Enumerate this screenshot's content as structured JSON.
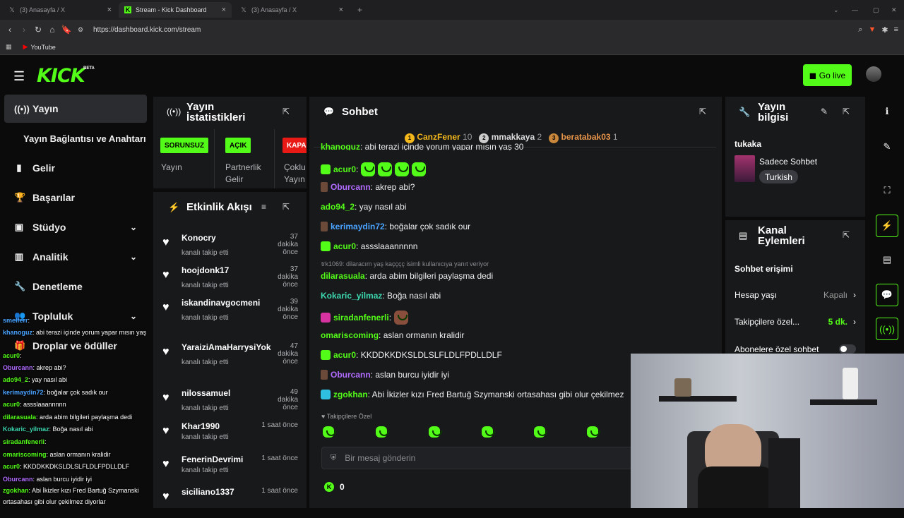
{
  "browser": {
    "tabs": [
      {
        "label": "(3) Anasayfa / X",
        "icon": "x-logo-icon"
      },
      {
        "label": "Stream - Kick Dashboard",
        "icon": "kick-logo-icon",
        "active": true
      },
      {
        "label": "(3) Anasayfa / X",
        "icon": "x-logo-icon"
      }
    ],
    "url": "https://dashboard.kick.com/stream",
    "bookmark": "YouTube"
  },
  "header": {
    "logo": "KICK",
    "beta": "BETA",
    "golive": "Go live",
    "colors": {
      "accent": "#53fc18",
      "panel": "#18191b"
    }
  },
  "sidebar": {
    "items": [
      {
        "label": "Yayın",
        "icon": "broadcast-icon"
      },
      {
        "label": "Yayın Bağlantısı ve Anahtarı",
        "icon": ""
      },
      {
        "label": "Gelir",
        "icon": "chart-icon"
      },
      {
        "label": "Başarılar",
        "icon": "trophy-icon"
      },
      {
        "label": "Stüdyo",
        "icon": "studio-icon"
      },
      {
        "label": "Analitik",
        "icon": "analytics-icon"
      },
      {
        "label": "Denetleme",
        "icon": "wrench-icon"
      },
      {
        "label": "Topluluk",
        "icon": "community-icon"
      },
      {
        "label": "Droplar ve ödüller",
        "icon": "gift-icon"
      }
    ]
  },
  "stats": {
    "title": "Yayın İstatistikleri",
    "badges": [
      {
        "label": "SORUNSUZ",
        "caption": "Yayın",
        "color": "#53fc18"
      },
      {
        "label": "AÇIK",
        "caption": "Partnerlik Gelir",
        "color": "#53fc18"
      },
      {
        "label": "KAPALI",
        "caption": "Çoklu Yayın",
        "color": "#e91916"
      }
    ]
  },
  "activity": {
    "title": "Etkinlik Akışı",
    "events": [
      {
        "name": "Konocry",
        "sub": "kanalı takip etti",
        "time": "37 dakika önce"
      },
      {
        "name": "hoojdonk17",
        "sub": "kanalı takip etti",
        "time": "37 dakika önce"
      },
      {
        "name": "iskandinavgocmeni",
        "sub": "kanalı takip etti",
        "time": "39 dakika önce"
      },
      {
        "name": "YaraiziAmaHarrysiYok",
        "sub": "kanalı takip etti",
        "time": "47 dakika önce"
      },
      {
        "name": "nilossamuel",
        "sub": "kanalı takip etti",
        "time": "49 dakika önce"
      },
      {
        "name": "Khar1990",
        "sub": "kanalı takip etti",
        "time": "1 saat önce"
      },
      {
        "name": "FenerinDevrimi",
        "sub": "kanalı takip etti",
        "time": "1 saat önce"
      },
      {
        "name": "siciliano1337",
        "sub": "",
        "time": "1 saat önce"
      }
    ]
  },
  "chat": {
    "title": "Sohbet",
    "top": [
      {
        "rank": "1",
        "name": "CanzFener",
        "count": "10"
      },
      {
        "rank": "2",
        "name": "mmakkaya",
        "count": "2"
      },
      {
        "rank": "3",
        "name": "beratabak03",
        "count": "1"
      }
    ],
    "messages": [
      {
        "user": "khanoguz",
        "color": "#53fc18",
        "text": ": abi terazi içinde yorum yapar mısın yaş 30"
      },
      {
        "user": "acur0",
        "color": "#53fc18",
        "text": ":"
      },
      {
        "user": "Oburcann",
        "color": "#b16cff",
        "text": ": akrep abi?"
      },
      {
        "user": "ado94_2",
        "color": "#53fc18",
        "text": ": yay nasıl abi"
      },
      {
        "user": "kerimaydin72",
        "color": "#4aa3ff",
        "text": ": boğalar çok sadık our"
      },
      {
        "user": "acur0",
        "color": "#53fc18",
        "text": ": assslaaannnnn"
      },
      {
        "user": "dilarasuala",
        "color": "#53fc18",
        "text": ": arda abim bilgileri paylaşma dedi"
      },
      {
        "user": "Kokaric_yilmaz",
        "color": "#3dd8b0",
        "text": ": Boğa nasıl abi"
      },
      {
        "user": "siradanfenerli",
        "color": "#53fc18",
        "text": ":"
      },
      {
        "user": "omariscoming",
        "color": "#53fc18",
        "text": ": aslan ormanın kralidir"
      },
      {
        "user": "acur0",
        "color": "#53fc18",
        "text": ": KKDDKKDKSLDLSLFLDLFPDLLDLF"
      },
      {
        "user": "Oburcann",
        "color": "#b16cff",
        "text": ": aslan burcu iyidir iyi"
      },
      {
        "user": "zgokhan",
        "color": "#53fc18",
        "text": ": Abi İkizler kızı Fred Bartuğ Szymanski ortasahası gibi olur çekilmez"
      }
    ],
    "reply": "trk1069: dilaracım yaş kaçççç isimli kullanıcıya yanıt veriyor",
    "followers_label": "Takipçilere Özel",
    "placeholder": "Bir mesaj gönderin",
    "kick_count": "0"
  },
  "info": {
    "title": "Yayın bilgisi",
    "user": "tukaka",
    "category": "Sadece Sohbet",
    "language": "Turkish"
  },
  "actions": {
    "title": "Kanal Eylemleri",
    "subtitle": "Sohbet erişimi",
    "rows": [
      {
        "label": "Hesap yaşı",
        "value": "Kapalı"
      },
      {
        "label": "Takipçilere özel...",
        "value": "5 dk."
      },
      {
        "label": "Abonelere özel sohbet",
        "value": ""
      }
    ]
  },
  "overlay_chat": [
    {
      "user": "smelferr",
      "text": ":",
      "color": "#4aa3ff"
    },
    {
      "user": "khanoguz",
      "text": ": abi terazi içinde yorum yapar mısın yaş",
      "color": "#4aa3ff"
    },
    {
      "user": "acur0",
      "text": ":",
      "color": "#53fc18"
    },
    {
      "user": "Oburcann",
      "text": ": akrep abi?",
      "color": "#b16cff"
    },
    {
      "user": "ado94_2",
      "text": ": yay nasıl abi",
      "color": "#53fc18"
    },
    {
      "user": "kerimaydin72",
      "text": ": boğalar çok sadık our",
      "color": "#4aa3ff"
    },
    {
      "user": "acur0",
      "text": ": assslaaannnnn",
      "color": "#53fc18"
    },
    {
      "user": "dilarasuala",
      "text": ": arda abim bilgileri paylaşma dedi",
      "color": "#53fc18"
    },
    {
      "user": "Kokaric_yilmaz",
      "text": ": Boğa nasıl abi",
      "color": "#3dd8b0"
    },
    {
      "user": "siradanfenerli",
      "text": ":",
      "color": "#53fc18"
    },
    {
      "user": "omariscoming",
      "text": ": aslan ormanın kralidir",
      "color": "#53fc18"
    },
    {
      "user": "acur0",
      "text": ": KKDDKKDKSLDLSLFLDLFPDLLDLF",
      "color": "#53fc18"
    },
    {
      "user": "Oburcann",
      "text": ": aslan burcu iyidir iyi",
      "color": "#b16cff"
    },
    {
      "user": "zgokhan",
      "text": ": Abi İkizler kızı Fred Bartuğ Szymanski",
      "color": "#53fc18"
    },
    {
      "user": "",
      "text": "ortasahası gibi olur çekilmez diyorlar",
      "color": "#fff"
    }
  ]
}
